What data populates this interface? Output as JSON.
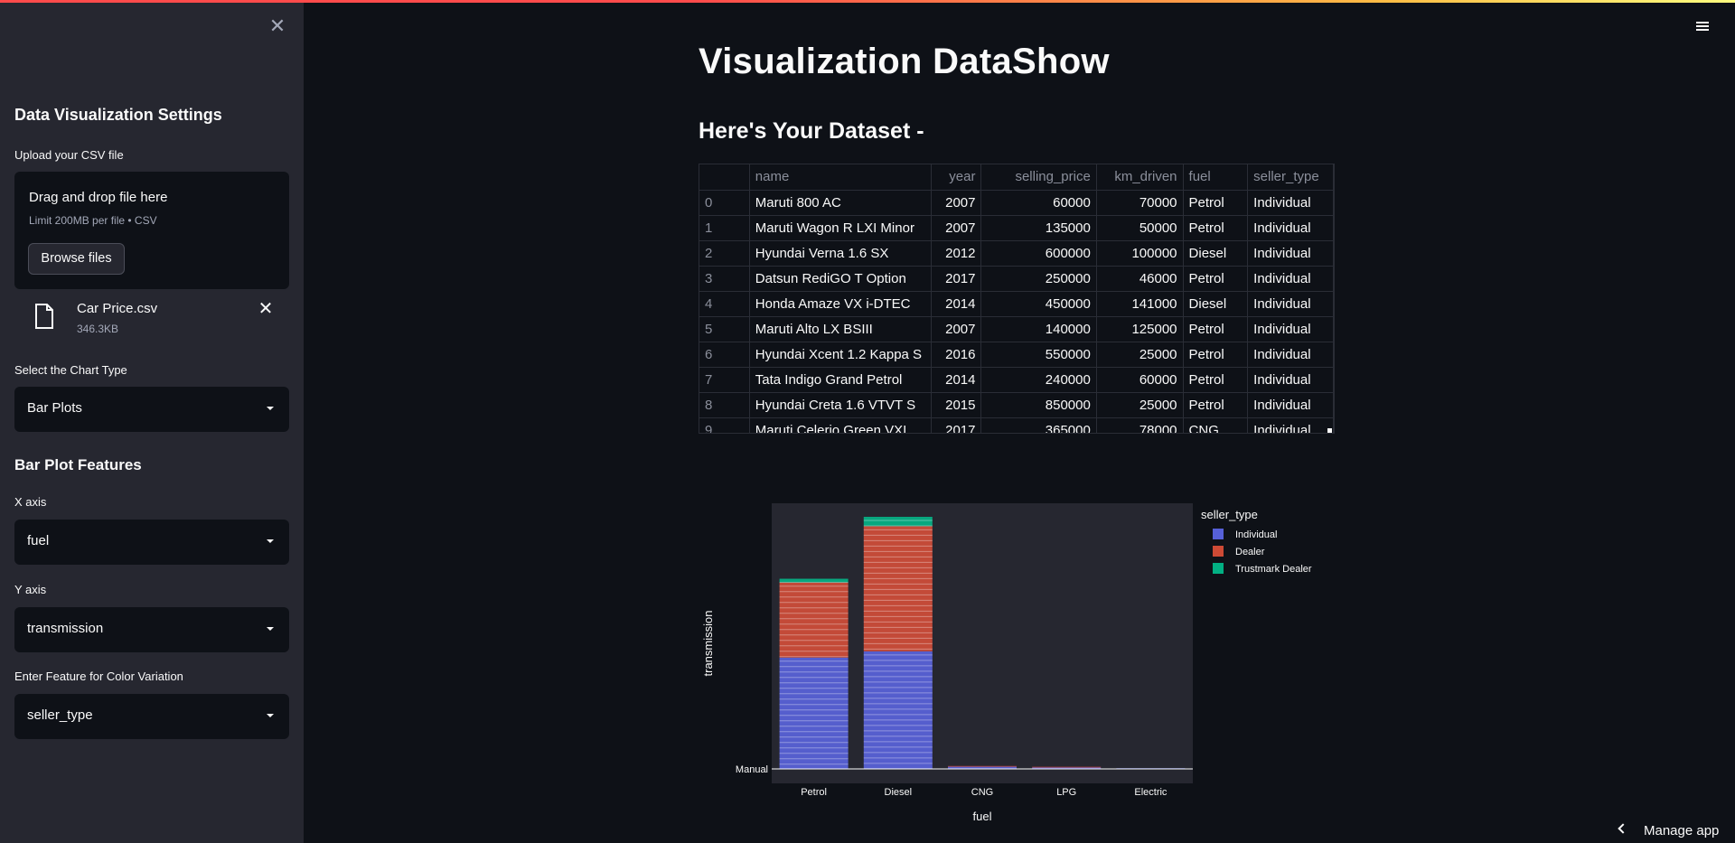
{
  "sidebar": {
    "title": "Data Visualization Settings",
    "upload_label": "Upload your CSV file",
    "uploader": {
      "drag_text": "Drag and drop file here",
      "limit_text": "Limit 200MB per file • CSV",
      "browse_label": "Browse files"
    },
    "file": {
      "name": "Car Price.csv",
      "size": "346.3KB"
    },
    "chart_type_label": "Select the Chart Type",
    "chart_type_value": "Bar Plots",
    "features_title": "Bar Plot Features",
    "x_label": "X axis",
    "x_value": "fuel",
    "y_label": "Y axis",
    "y_value": "transmission",
    "color_label": "Enter Feature for Color Variation",
    "color_value": "seller_type"
  },
  "header": {
    "manage_label": "Manage app"
  },
  "main": {
    "title": "Visualization DataShow",
    "subtitle": "Here's Your Dataset -"
  },
  "table": {
    "columns": [
      "",
      "name",
      "year",
      "selling_price",
      "km_driven",
      "fuel",
      "seller_type"
    ],
    "rows": [
      [
        "0",
        "Maruti 800 AC",
        "2007",
        "60000",
        "70000",
        "Petrol",
        "Individual"
      ],
      [
        "1",
        "Maruti Wagon R LXI Minor",
        "2007",
        "135000",
        "50000",
        "Petrol",
        "Individual"
      ],
      [
        "2",
        "Hyundai Verna 1.6 SX",
        "2012",
        "600000",
        "100000",
        "Diesel",
        "Individual"
      ],
      [
        "3",
        "Datsun RediGO T Option",
        "2017",
        "250000",
        "46000",
        "Petrol",
        "Individual"
      ],
      [
        "4",
        "Honda Amaze VX i-DTEC",
        "2014",
        "450000",
        "141000",
        "Diesel",
        "Individual"
      ],
      [
        "5",
        "Maruti Alto LX BSIII",
        "2007",
        "140000",
        "125000",
        "Petrol",
        "Individual"
      ],
      [
        "6",
        "Hyundai Xcent 1.2 Kappa S",
        "2016",
        "550000",
        "25000",
        "Petrol",
        "Individual"
      ],
      [
        "7",
        "Tata Indigo Grand Petrol",
        "2014",
        "240000",
        "60000",
        "Petrol",
        "Individual"
      ],
      [
        "8",
        "Hyundai Creta 1.6 VTVT S",
        "2015",
        "850000",
        "25000",
        "Petrol",
        "Individual"
      ],
      [
        "9",
        "Maruti Celerio Green VXI",
        "2017",
        "365000",
        "78000",
        "CNG",
        "Individual"
      ]
    ]
  },
  "chart_data": {
    "type": "bar",
    "barmode": "stack",
    "categories": [
      "Petrol",
      "Diesel",
      "CNG",
      "LPG",
      "Electric"
    ],
    "xlabel": "fuel",
    "ylabel": "transmission",
    "y_tick_labels": [
      "Manual"
    ],
    "legend_title": "seller_type",
    "legend_position": "top-right",
    "series": [
      {
        "name": "Individual",
        "color": "#636efa",
        "values": [
          1780,
          1880,
          35,
          22,
          1
        ]
      },
      {
        "name": "Dealer",
        "color": "#ef553b",
        "values": [
          1200,
          2000,
          5,
          1,
          0
        ]
      },
      {
        "name": "Trustmark Dealer",
        "color": "#00cc96",
        "values": [
          60,
          150,
          0,
          0,
          0
        ]
      }
    ],
    "colors": {
      "plot_bg": "#262730",
      "paper_bg": "#0e1117",
      "text": "#fafafa"
    }
  }
}
